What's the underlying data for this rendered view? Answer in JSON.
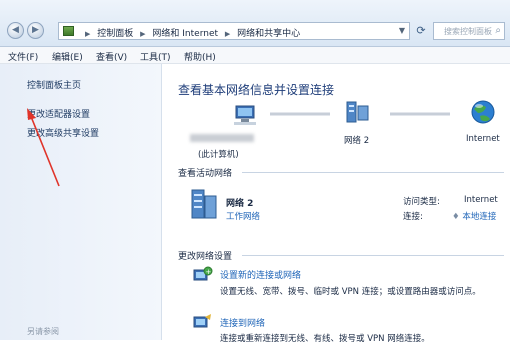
{
  "address_bar": {
    "crumbs": [
      "控制面板",
      "网络和 Internet",
      "网络和共享中心"
    ],
    "search_placeholder": "搜索控制面板"
  },
  "menu": {
    "items": [
      "文件(F)",
      "编辑(E)",
      "查看(V)",
      "工具(T)",
      "帮助(H)"
    ]
  },
  "sidebar": {
    "links": [
      "控制面板主页",
      "更改适配器设置",
      "更改高级共享设置"
    ],
    "see_also": "另请参阅"
  },
  "main": {
    "title": "查看基本网络信息并设置连接",
    "map": {
      "computer_label": "(此计算机)",
      "network_label": "网络 2",
      "internet_label": "Internet"
    },
    "active_networks": {
      "heading": "查看活动网络",
      "network_name": "网络 2",
      "network_type": "工作网络",
      "access_type_key": "访问类型:",
      "access_type_value": "Internet",
      "connection_key": "连接:",
      "connection_value": "本地连接"
    },
    "change_settings": {
      "heading": "更改网络设置",
      "items": [
        {
          "title": "设置新的连接或网络",
          "desc": "设置无线、宽带、拨号、临时或 VPN 连接；或设置路由器或访问点。"
        },
        {
          "title": "连接到网络",
          "desc": "连接或重新连接到无线、有线、拨号或 VPN 网络连接。"
        }
      ]
    }
  },
  "colors": {
    "link": "#1f65b8",
    "title": "#1e3d79",
    "arrow": "#e0342a"
  }
}
